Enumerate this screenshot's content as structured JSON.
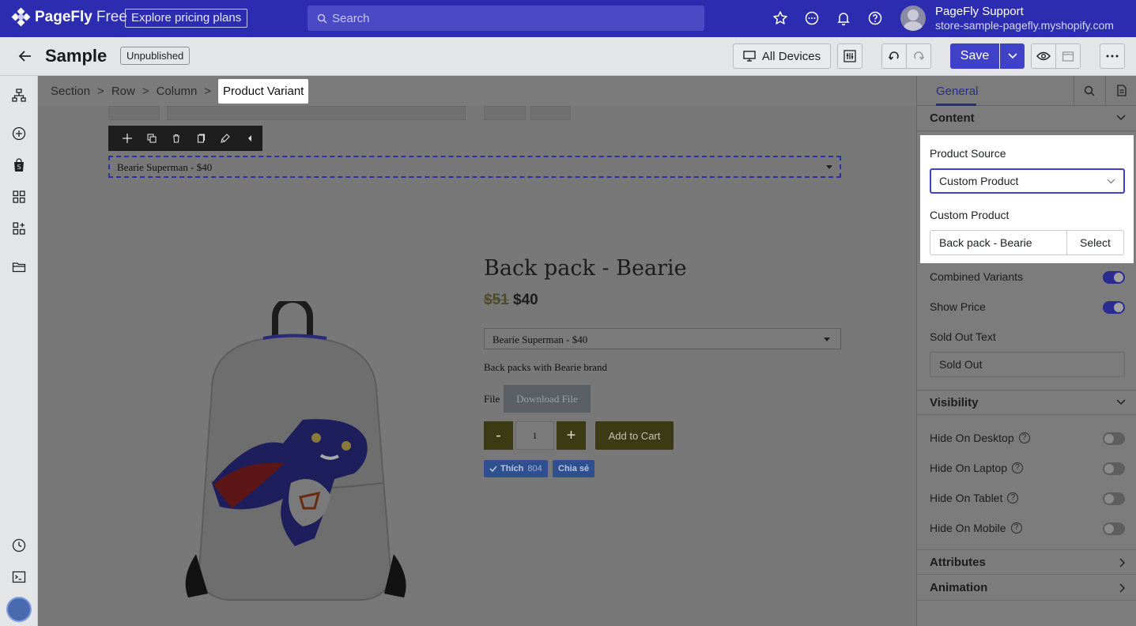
{
  "topbar": {
    "brand": "PageFly",
    "plan": "Free",
    "pricing_button": "Explore pricing plans",
    "search_placeholder": "Search",
    "user_name": "PageFly Support",
    "user_store": "store-sample-pagefly.myshopify.com"
  },
  "toolbar": {
    "page_title": "Sample",
    "status": "Unpublished",
    "devices_label": "All Devices",
    "save_label": "Save"
  },
  "breadcrumb": [
    "Section",
    "Row",
    "Column",
    "Product Variant"
  ],
  "canvas": {
    "selected_variant": "Bearie Superman - $40",
    "product_title": "Back pack - Bearie",
    "price_old": "$51",
    "price_new": "$40",
    "variant_option": "Bearie Superman - $40",
    "description": "Back packs with Bearie brand",
    "file_label": "File",
    "download_label": "Download File",
    "qty_minus": "-",
    "qty_value": "1",
    "qty_plus": "+",
    "add_to_cart": "Add to Cart",
    "fb_like": "Thích",
    "fb_like_count": "804",
    "fb_share": "Chia sẻ"
  },
  "panel": {
    "tab_general": "General",
    "content_section": "Content",
    "product_source_label": "Product Source",
    "product_source_value": "Custom Product",
    "custom_product_label": "Custom Product",
    "custom_product_value": "Back pack - Bearie",
    "select_button": "Select",
    "combined_variants": "Combined Variants",
    "combined_variants_on": true,
    "show_price": "Show Price",
    "show_price_on": true,
    "sold_out_label": "Sold Out Text",
    "sold_out_value": "Sold Out",
    "visibility_section": "Visibility",
    "hide_desktop": "Hide On Desktop",
    "hide_laptop": "Hide On Laptop",
    "hide_tablet": "Hide On Tablet",
    "hide_mobile": "Hide On Mobile",
    "attributes_section": "Attributes",
    "animation_section": "Animation"
  },
  "colors": {
    "brand": "#2b2cb0",
    "accent": "#3f41c9",
    "cart_button": "#3c3a15"
  }
}
